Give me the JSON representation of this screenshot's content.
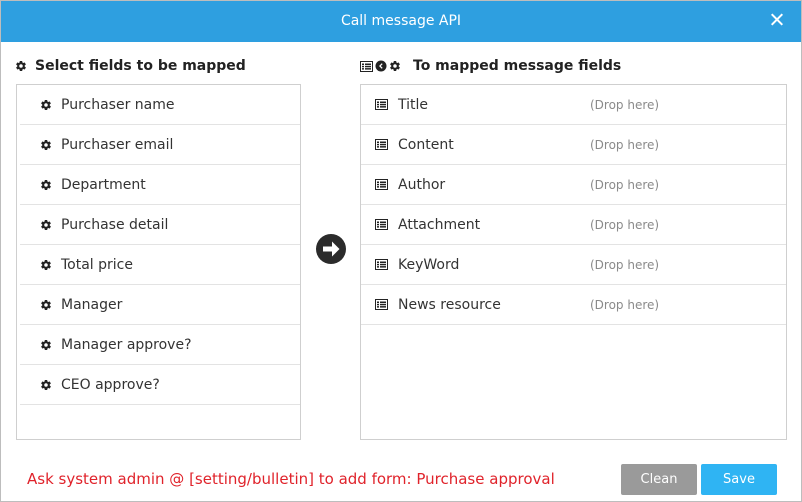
{
  "dialog": {
    "title": "Call message API"
  },
  "source": {
    "heading": "Select fields to be mapped",
    "fields": [
      {
        "label": "Purchaser name"
      },
      {
        "label": "Purchaser email"
      },
      {
        "label": "Department"
      },
      {
        "label": "Purchase detail"
      },
      {
        "label": "Total price"
      },
      {
        "label": "Manager"
      },
      {
        "label": "Manager approve?"
      },
      {
        "label": "CEO approve?"
      }
    ]
  },
  "target": {
    "heading": "To mapped message fields",
    "fields": [
      {
        "label": "Title",
        "placeholder": "(Drop here)"
      },
      {
        "label": "Content",
        "placeholder": "(Drop here)"
      },
      {
        "label": "Author",
        "placeholder": "(Drop here)"
      },
      {
        "label": "Attachment",
        "placeholder": "(Drop here)"
      },
      {
        "label": "KeyWord",
        "placeholder": "(Drop here)"
      },
      {
        "label": "News resource",
        "placeholder": "(Drop here)"
      }
    ]
  },
  "footer": {
    "message": "Ask system admin @ [setting/bulletin] to add form: Purchase approval",
    "clean_label": "Clean",
    "save_label": "Save"
  },
  "colors": {
    "titlebar": "#2e9fe0",
    "message": "#e0232b",
    "clean": "#9a9a9a",
    "save": "#2fb4f3"
  },
  "icons": {
    "field": "gear-icon",
    "target_field": "list-icon",
    "map": "arrow-right-circle-icon"
  }
}
